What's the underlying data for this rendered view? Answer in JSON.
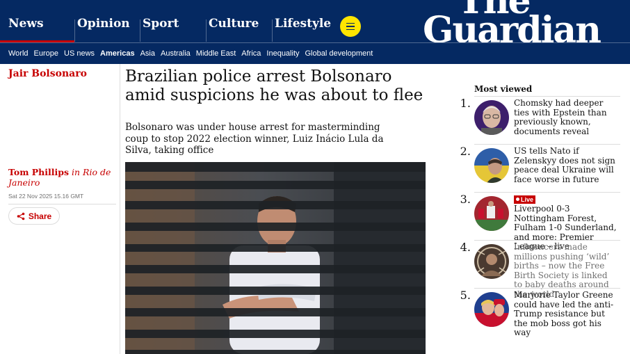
{
  "header": {
    "pillars": [
      {
        "label": "News",
        "active": true
      },
      {
        "label": "Opinion"
      },
      {
        "label": "Sport"
      },
      {
        "label": "Culture"
      },
      {
        "label": "Lifestyle"
      }
    ],
    "logo_line1": "The",
    "logo_line2": "Guardian",
    "subnav": [
      "World",
      "Europe",
      "US news",
      "Americas",
      "Asia",
      "Australia",
      "Middle East",
      "Africa",
      "Inequality",
      "Global development"
    ],
    "subnav_active": "Americas",
    "colors": {
      "brand": "#052962",
      "accent": "#c70000",
      "menu": "#ffe500"
    }
  },
  "article": {
    "section": "Jair Bolsonaro",
    "headline": "Brazilian police arrest Bolsonaro amid suspicions he was about to flee",
    "standfirst": "Bolsonaro was under house arrest for masterminding coup to stop 2022 election winner, Luiz Inácio Lula da Silva, taking office",
    "author": "Tom Phillips",
    "location": "in Rio de Janeiro",
    "date": "Sat 22 Nov 2025 15.16 GMT",
    "share_label": "Share"
  },
  "most_viewed": {
    "title": "Most viewed",
    "items": [
      {
        "text": "Chomsky had deeper ties with Epstein than previously known, documents reveal",
        "muted": false
      },
      {
        "text": "US tells Nato if Zelenskyy does not sign peace deal Ukraine will face worse in future",
        "muted": false
      },
      {
        "live": "Live",
        "text": "Liverpool 0-3 Nottingham Forest, Fulham 1-0 Sunderland, and more: Premier League – live",
        "muted": false
      },
      {
        "text": "Influencers made millions pushing ‘wild’ births – now the Free Birth Society is linked to baby deaths around the world",
        "muted": true
      },
      {
        "text": "Marjorie Taylor Greene could have led the anti-Trump resistance but the mob boss got his way",
        "muted": false
      }
    ]
  }
}
